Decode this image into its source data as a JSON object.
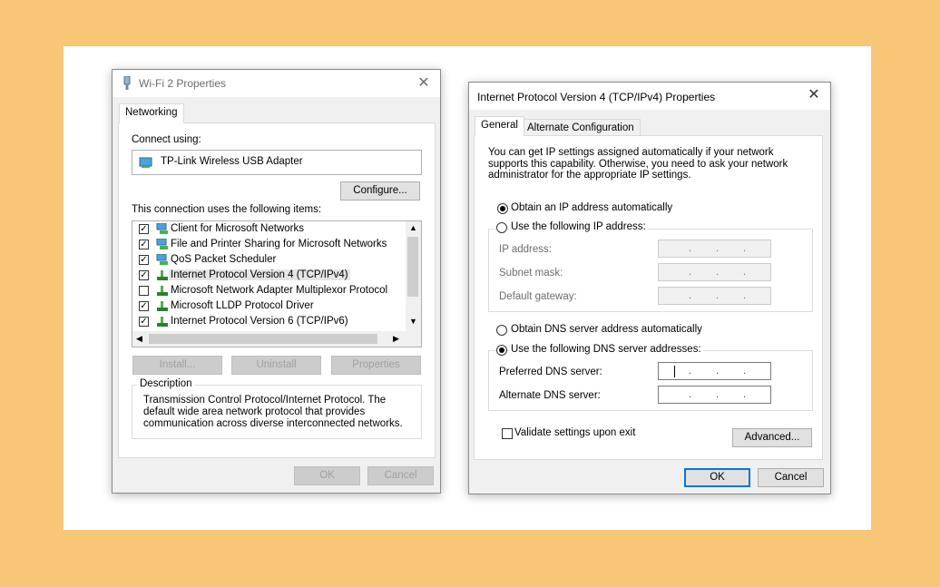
{
  "left_dialog": {
    "title": "Wi-Fi 2 Properties",
    "close_label": "✕",
    "tab": "Networking",
    "connect_using_label": "Connect using:",
    "adapter_name": "TP-Link Wireless USB Adapter",
    "configure_label": "Configure...",
    "items_label": "This connection uses the following items:",
    "items": [
      {
        "label": "Client for Microsoft Networks",
        "checked": true,
        "icon": "network-client-icon"
      },
      {
        "label": "File and Printer Sharing for Microsoft Networks",
        "checked": true,
        "icon": "file-sharing-icon"
      },
      {
        "label": "QoS Packet Scheduler",
        "checked": true,
        "icon": "qos-icon"
      },
      {
        "label": "Internet Protocol Version 4 (TCP/IPv4)",
        "checked": true,
        "icon": "protocol-icon",
        "selected": true
      },
      {
        "label": "Microsoft Network Adapter Multiplexor Protocol",
        "checked": false,
        "icon": "protocol-icon"
      },
      {
        "label": "Microsoft LLDP Protocol Driver",
        "checked": true,
        "icon": "protocol-icon"
      },
      {
        "label": "Internet Protocol Version 6 (TCP/IPv6)",
        "checked": true,
        "icon": "protocol-icon"
      }
    ],
    "install_label": "Install...",
    "uninstall_label": "Uninstall",
    "properties_label": "Properties",
    "description_heading": "Description",
    "description_text": "Transmission Control Protocol/Internet Protocol. The default wide area network protocol that provides communication across diverse interconnected networks.",
    "ok_label": "OK",
    "cancel_label": "Cancel"
  },
  "right_dialog": {
    "title": "Internet Protocol Version 4 (TCP/IPv4) Properties",
    "close_label": "✕",
    "tabs": [
      "General",
      "Alternate Configuration"
    ],
    "intro_text": "You can get IP settings assigned automatically if your network supports this capability. Otherwise, you need to ask your network administrator for the appropriate IP settings.",
    "obtain_ip_auto": "Obtain an IP address automatically",
    "use_following_ip": "Use the following IP address:",
    "ip_address_label": "IP address:",
    "subnet_mask_label": "Subnet mask:",
    "default_gateway_label": "Default gateway:",
    "obtain_dns_auto": "Obtain DNS server address automatically",
    "use_following_dns": "Use the following DNS server addresses:",
    "preferred_dns_label": "Preferred DNS server:",
    "alternate_dns_label": "Alternate DNS server:",
    "validate_label": "Validate settings upon exit",
    "advanced_label": "Advanced...",
    "ok_label": "OK",
    "cancel_label": "Cancel",
    "ip_dot": "."
  },
  "colors": {
    "background": "#f7c677",
    "focus_accent": "#0078d7"
  }
}
